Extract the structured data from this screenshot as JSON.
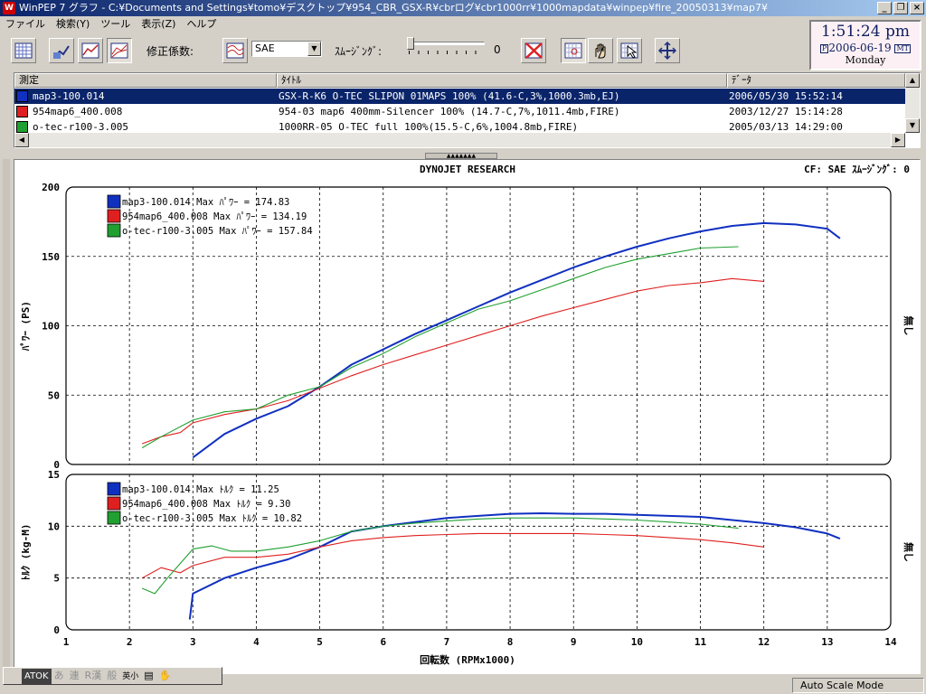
{
  "window": {
    "title": "WinPEP 7   グラフ - C:¥Documents and Settings¥tomo¥デスクトップ¥954_CBR_GSX-R¥cbrログ¥cbr1000rr¥1000mapdata¥winpep¥fire_20050313¥map7¥"
  },
  "menu": [
    "ファイル",
    "検索(Y)",
    "ツール",
    "表示(Z)",
    "ヘルプ"
  ],
  "toolbar": {
    "correction_label": "修正係数:",
    "correction_value": "SAE",
    "smoothing_label": "ｽﾑｰｼﾞﾝｸﾞ:",
    "smoothing_value": "0"
  },
  "clock": {
    "time": "1:51:24 pm",
    "date": "2006-06-19",
    "day": "Monday",
    "badge_left": "P",
    "badge_right": "MT"
  },
  "runs": {
    "headers": [
      "測定",
      "ﾀｲﾄﾙ",
      "ﾃﾞｰﾀ"
    ],
    "rows": [
      {
        "name": "map3-100.014",
        "title": "GSX-R-K6 O-TEC SLIPON 01MAPS 100% (41.6-C,3%,1000.3mb,EJ)",
        "date": "2006/05/30 15:52:14",
        "color": "#1030c0"
      },
      {
        "name": "954map6_400.008",
        "title": "954-03 map6 400mm-Silencer 100% (14.7-C,7%,1011.4mb,FIRE)",
        "date": "2003/12/27 15:14:28",
        "color": "#e02020"
      },
      {
        "name": "o-tec-r100-3.005",
        "title": "1000RR-05 O-TEC full 100%(15.5-C,6%,1004.8mb,FIRE)",
        "date": "2005/03/13 14:29:00",
        "color": "#20a030"
      }
    ]
  },
  "status": {
    "ime_atok": "ATOK",
    "ime_items": [
      "あ",
      "連",
      "R漢",
      "般",
      "英小"
    ],
    "mode": "Auto Scale Mode"
  },
  "chart_data": [
    {
      "type": "line",
      "title": "DYNOJET   RESEARCH",
      "header_right": "CF: SAE  ｽﾑｰｼﾞﾝｸﾞ: 0",
      "ylabel": "ﾊﾟﾜｰ (PS)",
      "right_label": "無し",
      "xlim": [
        1,
        14
      ],
      "ylim": [
        0,
        200
      ],
      "yticks": [
        0,
        50,
        100,
        150,
        200
      ],
      "grid": true,
      "legend": "top-left",
      "legend_entries": [
        "map3-100.014 Max ﾊﾟﾜｰ = 174.83",
        "954map6_400.008 Max ﾊﾟﾜｰ = 134.19",
        "o-tec-r100-3.005 Max ﾊﾟﾜｰ = 157.84"
      ],
      "series": [
        {
          "name": "map3-100.014",
          "color": "#1030c0",
          "x": [
            3.0,
            3.5,
            4.0,
            4.5,
            5.0,
            5.5,
            6.0,
            6.5,
            7.0,
            7.5,
            8.0,
            8.5,
            9.0,
            9.5,
            10.0,
            10.5,
            11.0,
            11.5,
            12.0,
            12.5,
            13.0,
            13.2
          ],
          "y": [
            5,
            22,
            33,
            42,
            56,
            72,
            83,
            94,
            104,
            114,
            124,
            133,
            142,
            150,
            157,
            163,
            168,
            172,
            174,
            173,
            170,
            163
          ]
        },
        {
          "name": "954map6_400.008",
          "color": "#e02020",
          "x": [
            2.2,
            2.5,
            2.8,
            3.0,
            3.5,
            4.0,
            4.5,
            5.0,
            5.5,
            6.0,
            6.5,
            7.0,
            7.5,
            8.0,
            8.5,
            9.0,
            9.5,
            10.0,
            10.5,
            11.0,
            11.5,
            12.0
          ],
          "y": [
            15,
            20,
            23,
            30,
            36,
            40,
            46,
            55,
            64,
            72,
            79,
            86,
            93,
            100,
            107,
            113,
            119,
            125,
            129,
            131,
            134,
            132
          ]
        },
        {
          "name": "o-tec-r100-3.005",
          "color": "#20a030",
          "x": [
            2.2,
            2.5,
            3.0,
            3.5,
            4.0,
            4.5,
            5.0,
            5.5,
            6.0,
            6.5,
            7.0,
            7.5,
            8.0,
            8.5,
            9.0,
            9.5,
            10.0,
            10.5,
            11.0,
            11.6
          ],
          "y": [
            12,
            20,
            32,
            38,
            40,
            50,
            56,
            70,
            80,
            92,
            102,
            112,
            118,
            126,
            134,
            142,
            148,
            152,
            156,
            157
          ]
        }
      ]
    },
    {
      "type": "line",
      "xlabel": "回転数 (RPMx1000)",
      "ylabel": "ﾄﾙｸ (kg-M)",
      "right_label": "無し",
      "xlim": [
        1,
        14
      ],
      "ylim": [
        0,
        15
      ],
      "xticks": [
        1,
        2,
        3,
        4,
        5,
        6,
        7,
        8,
        9,
        10,
        11,
        12,
        13,
        14
      ],
      "yticks": [
        0,
        5,
        10,
        15
      ],
      "grid": true,
      "legend": "top-left",
      "legend_entries": [
        "map3-100.014 Max ﾄﾙｸ = 11.25",
        "954map6_400.008 Max ﾄﾙｸ = 9.30",
        "o-tec-r100-3.005 Max ﾄﾙｸ = 10.82"
      ],
      "series": [
        {
          "name": "map3-100.014",
          "color": "#1030c0",
          "x": [
            2.95,
            3.0,
            3.5,
            4.0,
            4.5,
            5.0,
            5.5,
            6.0,
            6.5,
            7.0,
            7.5,
            8.0,
            8.5,
            9.0,
            9.5,
            10.0,
            10.5,
            11.0,
            11.5,
            12.0,
            12.5,
            13.0,
            13.2
          ],
          "y": [
            1.0,
            3.5,
            5.0,
            6.0,
            6.8,
            8.0,
            9.5,
            10.0,
            10.4,
            10.8,
            11.0,
            11.2,
            11.25,
            11.2,
            11.2,
            11.1,
            11.0,
            10.9,
            10.6,
            10.3,
            9.9,
            9.3,
            8.8
          ]
        },
        {
          "name": "954map6_400.008",
          "color": "#e02020",
          "x": [
            2.2,
            2.5,
            2.8,
            3.0,
            3.5,
            4.0,
            4.5,
            5.0,
            5.5,
            6.0,
            6.5,
            7.0,
            7.5,
            8.0,
            8.5,
            9.0,
            9.5,
            10.0,
            10.5,
            11.0,
            11.5,
            12.0
          ],
          "y": [
            5.0,
            6.0,
            5.5,
            6.2,
            7.0,
            7.0,
            7.3,
            8.0,
            8.6,
            8.9,
            9.1,
            9.2,
            9.3,
            9.3,
            9.3,
            9.3,
            9.2,
            9.1,
            8.9,
            8.7,
            8.4,
            8.0
          ]
        },
        {
          "name": "o-tec-r100-3.005",
          "color": "#20a030",
          "x": [
            2.2,
            2.4,
            2.6,
            3.0,
            3.3,
            3.6,
            4.0,
            4.5,
            5.0,
            5.5,
            6.0,
            6.5,
            7.0,
            7.5,
            8.0,
            8.5,
            9.0,
            9.5,
            10.0,
            10.5,
            11.0,
            11.6
          ],
          "y": [
            4.0,
            3.5,
            5.0,
            7.8,
            8.1,
            7.6,
            7.6,
            8.0,
            8.6,
            9.5,
            10.0,
            10.3,
            10.5,
            10.7,
            10.8,
            10.8,
            10.8,
            10.7,
            10.6,
            10.4,
            10.2,
            9.8
          ]
        }
      ]
    }
  ]
}
